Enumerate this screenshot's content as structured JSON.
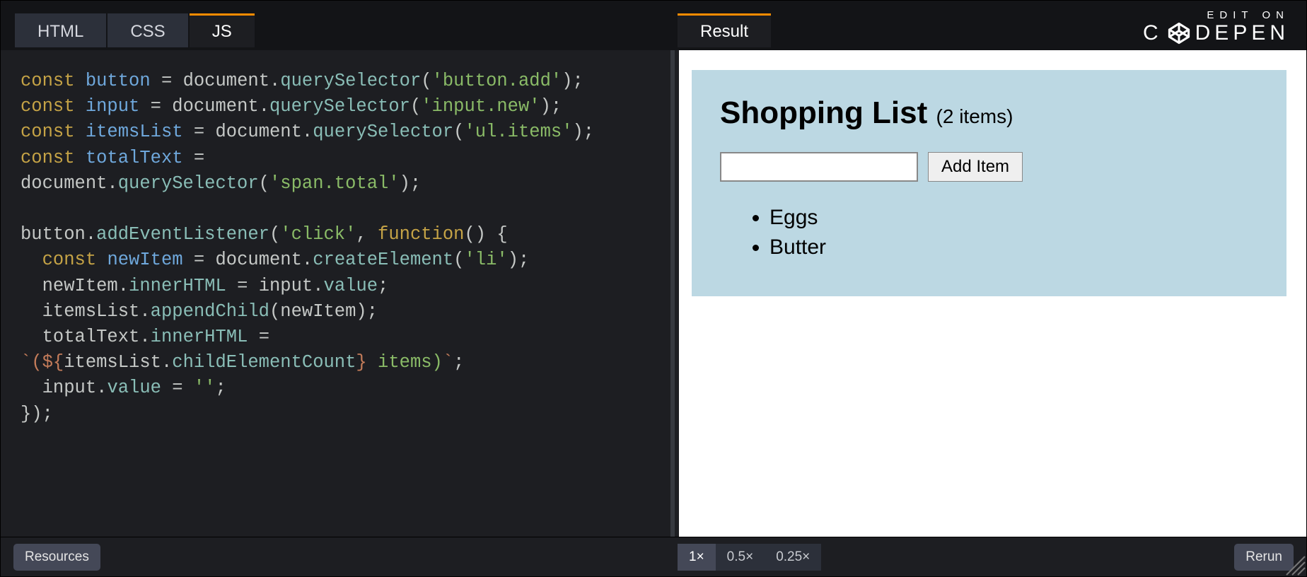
{
  "tabs": {
    "html": "HTML",
    "css": "CSS",
    "js": "JS",
    "result": "Result"
  },
  "branding": {
    "edit_on": "EDIT ON",
    "brand": "C   DEPEN"
  },
  "code": {
    "l1": {
      "kw": "const",
      "var": "button",
      "eq": " = ",
      "obj": "document",
      "dot": ".",
      "fn": "querySelector",
      "op": "(",
      "str": "'button.add'",
      "cl": ");"
    },
    "l2": {
      "kw": "const",
      "var": "input",
      "eq": " = ",
      "obj": "document",
      "dot": ".",
      "fn": "querySelector",
      "op": "(",
      "str": "'input.new'",
      "cl": ");"
    },
    "l3": {
      "kw": "const",
      "var": "itemsList",
      "eq": " = ",
      "obj": "document",
      "dot": ".",
      "fn": "querySelector",
      "op": "(",
      "str": "'ul.items'",
      "cl": ");"
    },
    "l4": {
      "kw": "const",
      "var": "totalText",
      "eq": " ="
    },
    "l5": {
      "obj": "document",
      "dot": ".",
      "fn": "querySelector",
      "op": "(",
      "str": "'span.total'",
      "cl": ");"
    },
    "l7a": "button",
    "l7b": "addEventListener",
    "l7c": "'click'",
    "l7d": "function",
    "l8": {
      "kw": "const",
      "var": "newItem",
      "eq": " = ",
      "obj": "document",
      "dot": ".",
      "fn": "createElement",
      "op": "(",
      "str": "'li'",
      "cl": ");"
    },
    "l9a": "newItem",
    "l9b": "innerHTML",
    "l9c": "input",
    "l9d": "value",
    "l10a": "itemsList",
    "l10b": "appendChild",
    "l10c": "newItem",
    "l11a": "totalText",
    "l11b": "innerHTML",
    "l12a": "`(",
    "l12b": "${",
    "l12c": "itemsList",
    "l12d": "childElementCount",
    "l12e": "}",
    "l12f": " items)",
    "l12g": "`",
    "l13a": "input",
    "l13b": "value",
    "l13c": "''",
    "l14": "});"
  },
  "preview": {
    "title": "Shopping List ",
    "count": "(2 items)",
    "button": "Add Item",
    "items": [
      "Eggs",
      "Butter"
    ]
  },
  "bottom": {
    "resources": "Resources",
    "zoom1": "1×",
    "zoom05": "0.5×",
    "zoom025": "0.25×",
    "rerun": "Rerun"
  }
}
